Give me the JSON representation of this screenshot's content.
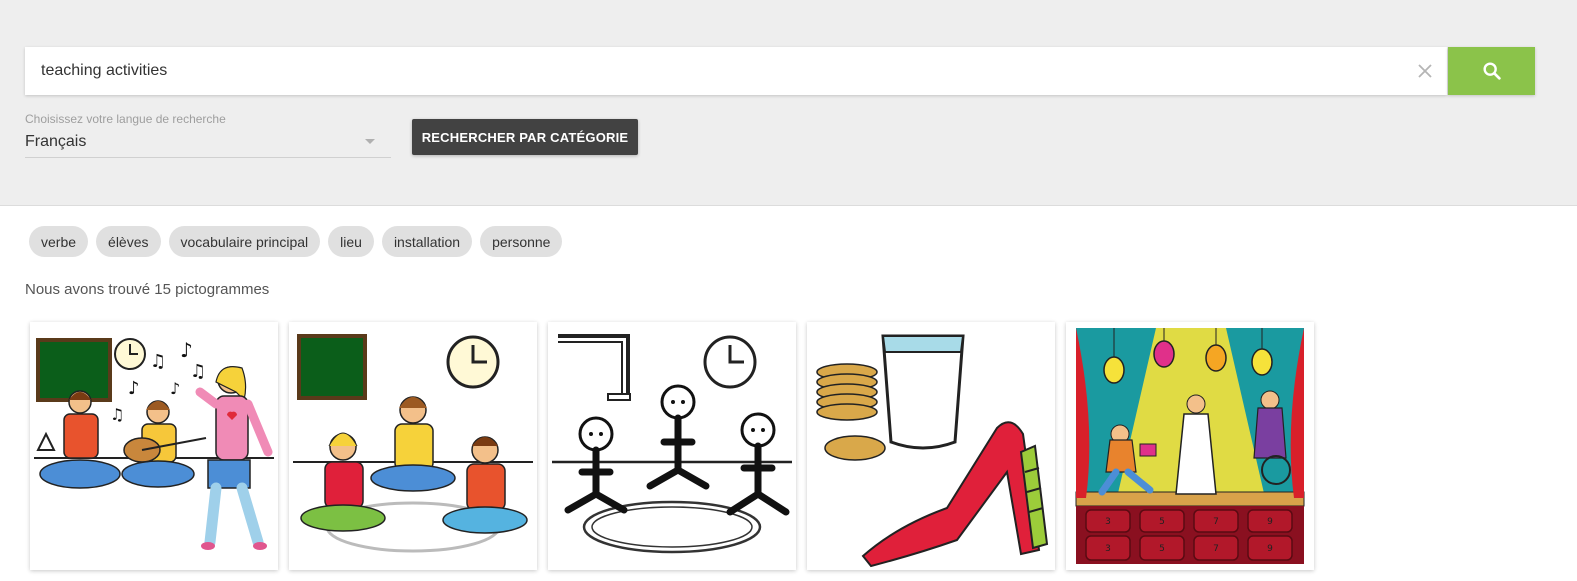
{
  "search": {
    "value": "teaching activities",
    "clear_icon": "close-icon",
    "button_icon": "search-icon",
    "button_color": "#8bc34a"
  },
  "language": {
    "label": "Choisissez votre langue de recherche",
    "selected": "Français"
  },
  "category_button": {
    "label": "RECHERCHER PAR CATÉGORIE"
  },
  "tags": [
    "verbe",
    "élèves",
    "vocabulaire principal",
    "lieu",
    "installation",
    "personne"
  ],
  "results": {
    "summary": "Nous avons trouvé 15 pictogrammes"
  },
  "pictograms": [
    {
      "name": "music-class-pictogram"
    },
    {
      "name": "circle-time-pictogram"
    },
    {
      "name": "stick-figures-circle-pictogram"
    },
    {
      "name": "snack-slide-pictogram"
    },
    {
      "name": "theater-stage-pictogram",
      "seat_numbers": [
        "3",
        "5",
        "7",
        "9",
        "3",
        "5",
        "7",
        "9"
      ]
    }
  ]
}
